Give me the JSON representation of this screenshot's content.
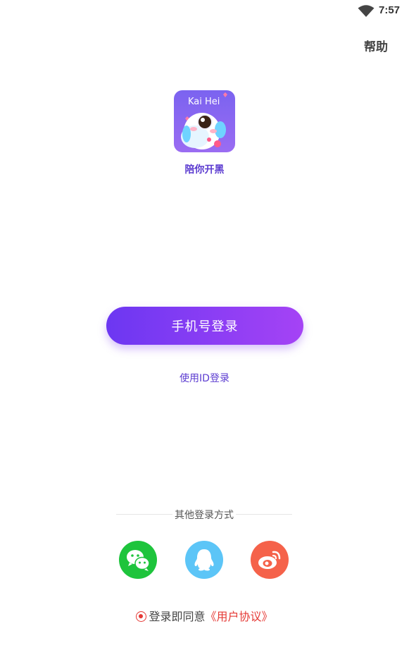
{
  "status_bar": {
    "time": "7:57",
    "wifi_icon": "wifi-icon"
  },
  "header": {
    "help_label": "帮助"
  },
  "app": {
    "logo_text": "Kai Hei",
    "name": "陪你开黑"
  },
  "login": {
    "phone_login_label": "手机号登录",
    "id_login_label": "使用ID登录"
  },
  "other_login": {
    "label": "其他登录方式",
    "providers": [
      {
        "name": "wechat",
        "icon": "wechat-icon",
        "color": "#1ec43c"
      },
      {
        "name": "qq",
        "icon": "qq-icon",
        "color": "#5cc5f7"
      },
      {
        "name": "weibo",
        "icon": "weibo-icon",
        "color": "#f5624a"
      }
    ]
  },
  "agreement": {
    "prefix": "登录即同意",
    "link": "《用户协议》"
  },
  "colors": {
    "accent": "#5b3bd0",
    "button_gradient_start": "#6c37f2",
    "button_gradient_end": "#a543f5",
    "agreement_red": "#e53935"
  }
}
